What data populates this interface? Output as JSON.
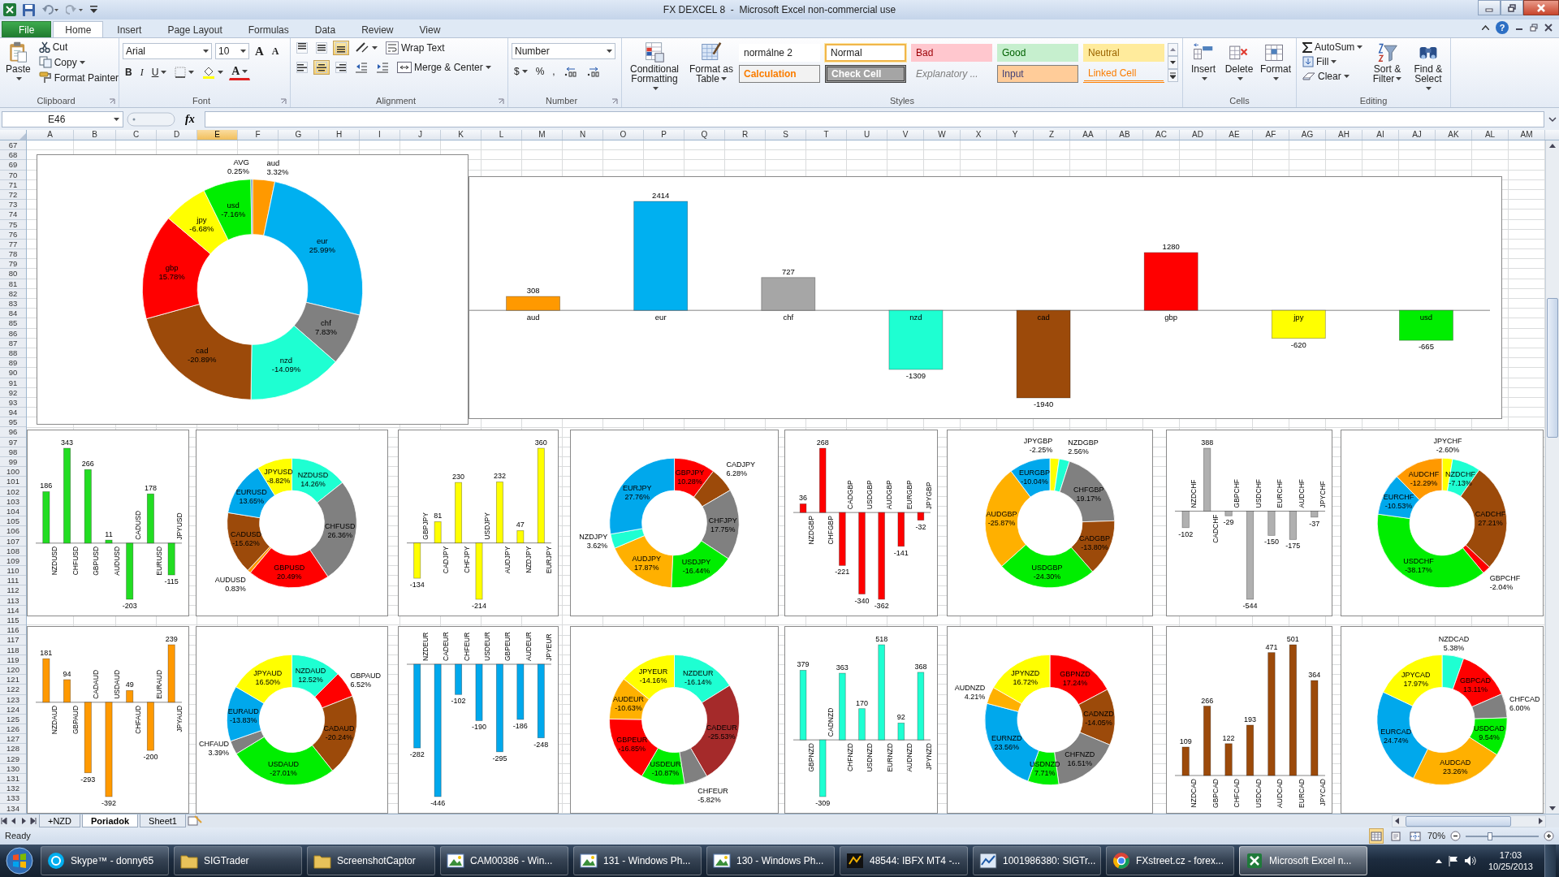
{
  "window": {
    "title": "FX DEXCEL 8  -  Microsoft Excel non-commercial use",
    "help": "?"
  },
  "ribbon_tabs": [
    {
      "label": "File",
      "kind": "file",
      "selected": false
    },
    {
      "label": "Home",
      "kind": "tab",
      "selected": true
    },
    {
      "label": "Insert",
      "kind": "tab",
      "selected": false
    },
    {
      "label": "Page Layout",
      "kind": "tab",
      "selected": false
    },
    {
      "label": "Formulas",
      "kind": "tab",
      "selected": false
    },
    {
      "label": "Data",
      "kind": "tab",
      "selected": false
    },
    {
      "label": "Review",
      "kind": "tab",
      "selected": false
    },
    {
      "label": "View",
      "kind": "tab",
      "selected": false
    }
  ],
  "clipboard": {
    "label": "Clipboard",
    "paste": "Paste",
    "cut": "Cut",
    "copy": "Copy",
    "format_painter": "Format Painter"
  },
  "font": {
    "label": "Font",
    "family": "Arial",
    "size": "10",
    "grow": "A",
    "shrink": "A",
    "bold": "B",
    "italic": "I",
    "underline": "U",
    "color_letter": "A"
  },
  "alignment": {
    "label": "Alignment",
    "wrap": "Wrap Text",
    "merge": "Merge & Center",
    "vertical_align": [
      {
        "selected": false
      },
      {
        "selected": false
      },
      {
        "selected": true
      }
    ],
    "horizontal_align": [
      {
        "selected": false
      },
      {
        "selected": true
      },
      {
        "selected": false
      }
    ]
  },
  "number": {
    "label": "Number",
    "format": "Number",
    "currency": "$",
    "percent": "%",
    "comma": ","
  },
  "styles": {
    "label": "Styles",
    "conditional": "Conditional Formatting",
    "as_table": "Format as Table",
    "cells": [
      {
        "label": "normálne 2",
        "kind": "plain",
        "selected": false
      },
      {
        "label": "Normal",
        "kind": "normal",
        "selected": true
      },
      {
        "label": "Bad",
        "kind": "bad",
        "selected": false
      },
      {
        "label": "Good",
        "kind": "good",
        "selected": false
      },
      {
        "label": "Neutral",
        "kind": "neutral",
        "selected": false
      },
      {
        "label": "Calculation",
        "kind": "calculation",
        "selected": false
      },
      {
        "label": "Check Cell",
        "kind": "check",
        "selected": false
      },
      {
        "label": "Explanatory ...",
        "kind": "explanatory",
        "selected": false
      },
      {
        "label": "Input",
        "kind": "input",
        "selected": false
      },
      {
        "label": "Linked Cell",
        "kind": "linked",
        "selected": false
      }
    ]
  },
  "cells": {
    "label": "Cells",
    "insert": "Insert",
    "delete": "Delete",
    "format": "Format"
  },
  "editing": {
    "label": "Editing",
    "autosum": "AutoSum",
    "fill": "Fill",
    "clear": "Clear",
    "sort": "Sort & Filter",
    "find": "Find & Select"
  },
  "formula_bar": {
    "name_box": "E46",
    "fx": "fx"
  },
  "columns": [
    {
      "label": "A",
      "selected": false
    },
    {
      "label": "B",
      "selected": false
    },
    {
      "label": "C",
      "selected": false
    },
    {
      "label": "D",
      "selected": false
    },
    {
      "label": "E",
      "selected": true
    },
    {
      "label": "F",
      "selected": false
    },
    {
      "label": "G",
      "selected": false
    },
    {
      "label": "H",
      "selected": false
    },
    {
      "label": "I",
      "selected": false
    },
    {
      "label": "J",
      "selected": false
    },
    {
      "label": "K",
      "selected": false
    },
    {
      "label": "L",
      "selected": false
    },
    {
      "label": "M",
      "selected": false
    },
    {
      "label": "N",
      "selected": false
    },
    {
      "label": "O",
      "selected": false
    },
    {
      "label": "P",
      "selected": false
    },
    {
      "label": "Q",
      "selected": false
    },
    {
      "label": "R",
      "selected": false
    },
    {
      "label": "S",
      "selected": false
    },
    {
      "label": "T",
      "selected": false
    },
    {
      "label": "U",
      "selected": false
    },
    {
      "label": "V",
      "selected": false
    },
    {
      "label": "W",
      "selected": false
    },
    {
      "label": "X",
      "selected": false
    },
    {
      "label": "Y",
      "selected": false
    },
    {
      "label": "Z",
      "selected": false
    },
    {
      "label": "AA",
      "selected": false
    },
    {
      "label": "AB",
      "selected": false
    },
    {
      "label": "AC",
      "selected": false
    },
    {
      "label": "AD",
      "selected": false
    },
    {
      "label": "AE",
      "selected": false
    },
    {
      "label": "AF",
      "selected": false
    },
    {
      "label": "AG",
      "selected": false
    },
    {
      "label": "AH",
      "selected": false
    },
    {
      "label": "AI",
      "selected": false
    },
    {
      "label": "AJ",
      "selected": false
    },
    {
      "label": "AK",
      "selected": false
    },
    {
      "label": "AL",
      "selected": false
    },
    {
      "label": "AM",
      "selected": false
    }
  ],
  "rows": [
    "67",
    "68",
    "69",
    "70",
    "71",
    "72",
    "73",
    "74",
    "75",
    "76",
    "77",
    "78",
    "79",
    "80",
    "81",
    "82",
    "83",
    "84",
    "85",
    "86",
    "87",
    "88",
    "89",
    "90",
    "91",
    "92",
    "93",
    "94",
    "95",
    "96",
    "97",
    "98",
    "99",
    "100",
    "101",
    "102",
    "103",
    "104",
    "105",
    "106",
    "107",
    "108",
    "109",
    "110",
    "111",
    "112",
    "113",
    "114",
    "115",
    "116",
    "117",
    "118",
    "119",
    "120",
    "121",
    "122",
    "123",
    "124",
    "125",
    "126",
    "127",
    "128",
    "129",
    "130",
    "131",
    "132",
    "133",
    "134"
  ],
  "charts": [
    {
      "chart_data": {
        "type": "donut",
        "categories": [
          "aud",
          "eur",
          "chf",
          "nzd",
          "cad",
          "gbp",
          "jpy",
          "usd",
          "AVG"
        ],
        "series": [
          {
            "values": [
              3.32,
              25.99,
              7.83,
              14.09,
              20.89,
              15.78,
              6.68,
              7.16,
              0.25
            ],
            "colors": [
              "#ff9900",
              "#00b0f0",
              "#808080",
              "#1effd2",
              "#9c4a0a",
              "#ff0000",
              "#ffff00",
              "#00ee00",
              "#4f81bd"
            ]
          }
        ],
        "value_labels": [
          "3.32%",
          "25.99%",
          "7.83%",
          "-14.09%",
          "-20.89%",
          "15.78%",
          "-6.68%",
          "-7.16%",
          "0.25%"
        ]
      }
    },
    {
      "chart_data": {
        "type": "bar",
        "categories": [
          "aud",
          "eur",
          "chf",
          "nzd",
          "cad",
          "gbp",
          "jpy",
          "usd"
        ],
        "series": [
          {
            "values": [
              308,
              2414,
              727,
              -1309,
              -1940,
              1280,
              -620,
              -665
            ],
            "colors": [
              "#ff9900",
              "#00b0f0",
              "#a6a6a6",
              "#1effd2",
              "#9c4a0a",
              "#ff0000",
              "#ffff00",
              "#00ee00"
            ]
          }
        ],
        "data_labels": true
      }
    },
    {
      "chart_data": {
        "type": "bar",
        "categories": [
          "NZDUSD",
          "CHFUSD",
          "GBPUSD",
          "AUDUSD",
          "CADUSD",
          "EURUSD",
          "JPYUSD"
        ],
        "series": [
          {
            "color": "#22dd22",
            "values": [
              186,
              343,
              266,
              11,
              -203,
              178,
              -115
            ]
          }
        ],
        "data_labels": true
      }
    },
    {
      "chart_data": {
        "type": "donut",
        "categories": [
          "NZDUSD",
          "CHFUSD",
          "GBPUSD",
          "AUDUSD",
          "CADUSD",
          "EURUSD",
          "JPYUSD"
        ],
        "series": [
          {
            "values": [
              14.26,
              26.36,
              20.49,
              0.83,
              15.62,
              13.65,
              8.82
            ],
            "colors": [
              "#1effd2",
              "#808080",
              "#ff0000",
              "#ff9900",
              "#9c4a0a",
              "#00a8ec",
              "#ffff00"
            ]
          }
        ],
        "value_labels": [
          "14.26%",
          "26.36%",
          "20.49%",
          "0.83%",
          "-15.62%",
          "13.65%",
          "-8.82%"
        ]
      }
    },
    {
      "chart_data": {
        "type": "bar",
        "categories": [
          "GBPJPY",
          "CADJPY",
          "CHFJPY",
          "USDJPY",
          "AUDJPY",
          "NZDJPY",
          "EURJPY"
        ],
        "series": [
          {
            "color": "#ffff00",
            "values": [
              -134,
              81,
              230,
              -214,
              232,
              47,
              360
            ]
          }
        ],
        "data_labels": true
      }
    },
    {
      "chart_data": {
        "type": "donut",
        "categories": [
          "GBPJPY",
          "CADJPY",
          "CHFJPY",
          "USDJPY",
          "AUDJPY",
          "NZDJPY",
          "EURJPY"
        ],
        "series": [
          {
            "values": [
              10.28,
              6.28,
              17.75,
              16.44,
              17.87,
              3.62,
              27.76
            ],
            "colors": [
              "#ff0000",
              "#9c4a0a",
              "#808080",
              "#00ee00",
              "#ffb000",
              "#1effd2",
              "#00a8ec"
            ]
          }
        ],
        "value_labels": [
          "10.28%",
          "6.28%",
          "17.75%",
          "-16.44%",
          "17.87%",
          "3.62%",
          "27.76%"
        ]
      }
    },
    {
      "chart_data": {
        "type": "bar",
        "categories": [
          "NZDGBP",
          "CHFGBP",
          "CADGBP",
          "USDGBP",
          "AUDGBP",
          "EURGBP",
          "JPYGBP"
        ],
        "series": [
          {
            "color": "#ff0000",
            "values": [
              36,
              268,
              -221,
              -340,
              -362,
              -141,
              -32
            ]
          }
        ],
        "data_labels": true
      }
    },
    {
      "chart_data": {
        "type": "donut",
        "categories": [
          "JPYGBP",
          "NZDGBP",
          "CHFGBP",
          "CADGBP",
          "USDGBP",
          "AUDGBP",
          "EURGBP"
        ],
        "series": [
          {
            "values": [
              2.25,
              2.56,
              19.17,
              13.8,
              24.3,
              25.87,
              10.04
            ],
            "colors": [
              "#ffff00",
              "#1effd2",
              "#808080",
              "#9c4a0a",
              "#00ee00",
              "#ffb000",
              "#00a8ec"
            ]
          }
        ],
        "value_labels": [
          "-2.25%",
          "2.56%",
          "19.17%",
          "-13.80%",
          "-24.30%",
          "-25.87%",
          "-10.04%"
        ]
      }
    },
    {
      "chart_data": {
        "type": "bar",
        "categories": [
          "NZDCHF",
          "CADCHF",
          "GBPCHF",
          "USDCHF",
          "EURCHF",
          "AUDCHF",
          "JPYCHF"
        ],
        "series": [
          {
            "color": "#b0b0b0",
            "values": [
              -102,
              388,
              -29,
              -544,
              -150,
              -175,
              -37
            ]
          }
        ],
        "data_labels": true
      }
    },
    {
      "chart_data": {
        "type": "donut",
        "categories": [
          "JPYCHF",
          "NZDCHF",
          "CADCHF",
          "GBPCHF",
          "USDCHF",
          "EURCHF",
          "AUDCHF"
        ],
        "series": [
          {
            "values": [
              2.6,
              7.13,
              27.21,
              2.04,
              38.17,
              10.53,
              12.29
            ],
            "colors": [
              "#ffff00",
              "#1effd2",
              "#9c4a0a",
              "#ff0000",
              "#00ee00",
              "#00a8ec",
              "#ff9900"
            ]
          }
        ],
        "value_labels": [
          "-2.60%",
          "-7.13%",
          "27.21%",
          "-2.04%",
          "-38.17%",
          "-10.53%",
          "-12.29%"
        ]
      }
    },
    {
      "chart_data": {
        "type": "bar",
        "categories": [
          "NZDAUD",
          "GBPAUD",
          "CADAUD",
          "USDAUD",
          "CHFAUD",
          "EURAUD",
          "JPYAUD"
        ],
        "series": [
          {
            "color": "#ff9900",
            "values": [
              181,
              94,
              -293,
              -392,
              49,
              -200,
              239
            ]
          }
        ],
        "data_labels": true
      }
    },
    {
      "chart_data": {
        "type": "donut",
        "categories": [
          "NZDAUD",
          "GBPAUD",
          "CADAUD",
          "USDAUD",
          "CHFAUD",
          "EURAUD",
          "JPYAUD"
        ],
        "series": [
          {
            "values": [
              12.52,
              6.52,
              20.24,
              27.01,
              3.39,
              13.83,
              16.5
            ],
            "colors": [
              "#1effd2",
              "#ff0000",
              "#9c4a0a",
              "#00ee00",
              "#808080",
              "#00a8ec",
              "#ffff00"
            ]
          }
        ],
        "value_labels": [
          "12.52%",
          "6.52%",
          "-20.24%",
          "-27.01%",
          "3.39%",
          "-13.83%",
          "16.50%"
        ]
      }
    },
    {
      "chart_data": {
        "type": "bar",
        "categories": [
          "NZDEUR",
          "CADEUR",
          "CHFEUR",
          "USDEUR",
          "GBPEUR",
          "AUDEUR",
          "JPYEUR"
        ],
        "series": [
          {
            "color": "#00a8ec",
            "values": [
              -282,
              -446,
              -102,
              -190,
              -295,
              -186,
              -248
            ]
          }
        ],
        "data_labels": true
      }
    },
    {
      "chart_data": {
        "type": "donut",
        "categories": [
          "NZDEUR",
          "CADEUR",
          "CHFEUR",
          "USDEUR",
          "GBPEUR",
          "AUDEUR",
          "JPYEUR"
        ],
        "series": [
          {
            "values": [
              16.14,
              25.53,
              5.82,
              10.87,
              16.85,
              10.63,
              14.16
            ],
            "colors": [
              "#1effd2",
              "#a52a2a",
              "#808080",
              "#00ee00",
              "#ff0000",
              "#ffb000",
              "#ffff00"
            ]
          }
        ],
        "value_labels": [
          "-16.14%",
          "-25.53%",
          "-5.82%",
          "-10.87%",
          "-16.85%",
          "-10.63%",
          "-14.16%"
        ]
      }
    },
    {
      "chart_data": {
        "type": "bar",
        "categories": [
          "GBPNZD",
          "CADNZD",
          "CHFNZD",
          "USDNZD",
          "EURNZD",
          "AUDNZD",
          "JPYNZD"
        ],
        "series": [
          {
            "color": "#1effd2",
            "values": [
              379,
              -309,
              363,
              170,
              518,
              92,
              368
            ]
          }
        ],
        "data_labels": true
      }
    },
    {
      "chart_data": {
        "type": "donut",
        "categories": [
          "GBPNZD",
          "CADNZD",
          "CHFNZD",
          "USDNZD",
          "EURNZD",
          "AUDNZD",
          "JPYNZD"
        ],
        "series": [
          {
            "values": [
              17.24,
              14.05,
              16.51,
              7.71,
              23.56,
              4.21,
              16.72
            ],
            "colors": [
              "#ff0000",
              "#9c4a0a",
              "#808080",
              "#00ee00",
              "#00a8ec",
              "#ffb000",
              "#ffff00"
            ]
          }
        ],
        "value_labels": [
          "17.24%",
          "-14.05%",
          "16.51%",
          "7.71%",
          "23.56%",
          "4.21%",
          "16.72%"
        ]
      }
    },
    {
      "chart_data": {
        "type": "bar",
        "categories": [
          "NZDCAD",
          "GBPCAD",
          "CHFCAD",
          "USDCAD",
          "AUDCAD",
          "EURCAD",
          "JPYCAD"
        ],
        "series": [
          {
            "color": "#9c4a0a",
            "values": [
              109,
              266,
              122,
              193,
              471,
              501,
              364
            ]
          }
        ],
        "data_labels": true
      }
    },
    {
      "chart_data": {
        "type": "donut",
        "categories": [
          "NZDCAD",
          "GBPCAD",
          "CHFCAD",
          "USDCAD",
          "AUDCAD",
          "EURCAD",
          "JPYCAD"
        ],
        "series": [
          {
            "values": [
              5.38,
              13.11,
              6,
              9.54,
              23.26,
              24.74,
              17.97
            ],
            "colors": [
              "#1effd2",
              "#ff0000",
              "#808080",
              "#00ee00",
              "#ffb000",
              "#00a8ec",
              "#ffff00"
            ]
          }
        ],
        "value_labels": [
          "5.38%",
          "13.11%",
          "6.00%",
          "9.54%",
          "23.26%",
          "24.74%",
          "17.97%"
        ]
      }
    }
  ],
  "sheet_tabs": [
    {
      "label": "+NZD",
      "selected": false
    },
    {
      "label": "Poriadok",
      "selected": true
    },
    {
      "label": "Sheet1",
      "selected": false
    }
  ],
  "status_bar": {
    "text": "Ready",
    "views": [
      {
        "selected": true
      },
      {
        "selected": false
      },
      {
        "selected": false
      }
    ],
    "zoom": "70%",
    "level": 0.33
  },
  "taskbar": {
    "items": [
      {
        "label": "Skype™ - donny65",
        "kind": "skype",
        "selected": false
      },
      {
        "label": "SIGTrader",
        "kind": "folder",
        "selected": false
      },
      {
        "label": "ScreenshotCaptor",
        "kind": "folder",
        "selected": false
      },
      {
        "label": "CAM00386 - Win...",
        "kind": "photo",
        "selected": false
      },
      {
        "label": "131 - Windows Ph...",
        "kind": "photo",
        "selected": false
      },
      {
        "label": "130 - Windows Ph...",
        "kind": "photo",
        "selected": false
      },
      {
        "label": "48544: IBFX MT4 -...",
        "kind": "terminal",
        "selected": false
      },
      {
        "label": "1001986380: SIGTr...",
        "kind": "sig",
        "selected": false
      },
      {
        "label": "FXstreet.cz - forex...",
        "kind": "browser",
        "selected": false
      },
      {
        "label": "Microsoft Excel n...",
        "kind": "excel",
        "selected": true
      }
    ],
    "time": "17:03",
    "date": "10/25/2013"
  }
}
